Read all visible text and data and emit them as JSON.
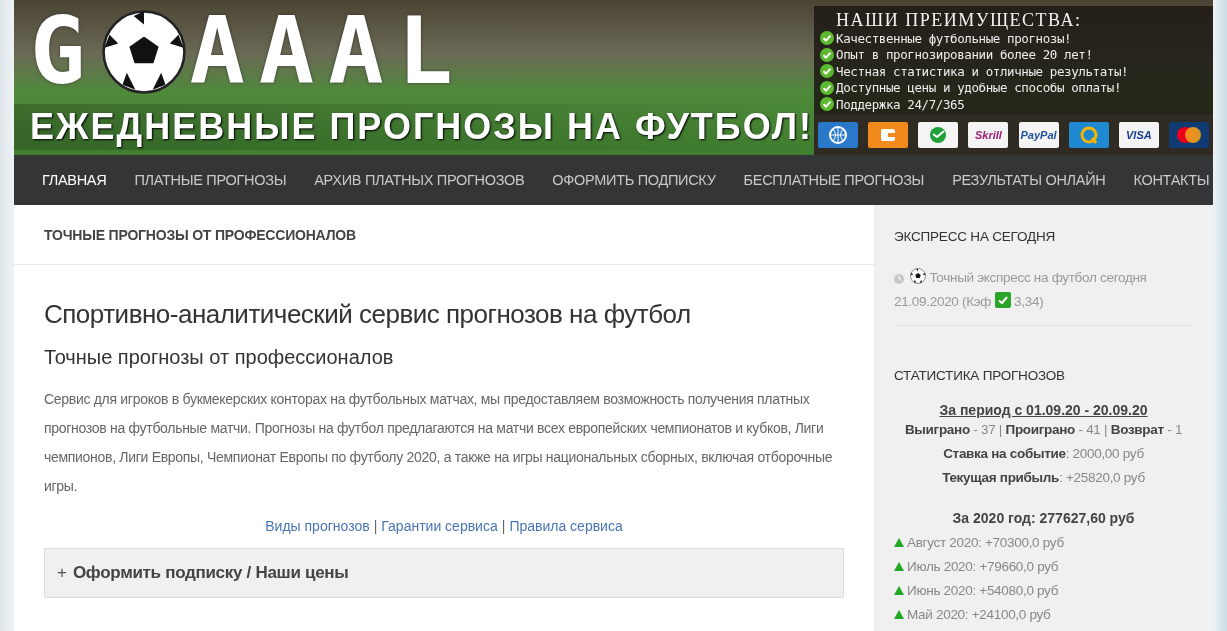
{
  "banner": {
    "logo": {
      "first": "G",
      "rest": "AAAL"
    },
    "tagline": "ЕЖЕДНЕВНЫЕ ПРОГНОЗЫ НА ФУТБОЛ!",
    "advantages": {
      "title": "НАШИ ПРЕИМУЩЕСТВА:",
      "items": [
        "Качественные футбольные прогнозы!",
        "Опыт в прогнозировании более 20 лет!",
        "Честная статистика и отличные результаты!",
        "Доступные цены и удобные способы оплаты!",
        "Поддержка 24/7/365"
      ]
    },
    "payments": [
      {
        "kind": "webmoney"
      },
      {
        "kind": "yandex"
      },
      {
        "kind": "sber"
      },
      {
        "kind": "skrill",
        "text": "Skrill"
      },
      {
        "kind": "paypal",
        "text": "PayPal"
      },
      {
        "kind": "qiwi"
      },
      {
        "kind": "visa",
        "text": "VISA"
      },
      {
        "kind": "mastercard"
      }
    ]
  },
  "nav": [
    {
      "label": "ГЛАВНАЯ",
      "selected": true
    },
    {
      "label": "ПЛАТНЫЕ ПРОГНОЗЫ",
      "selected": false
    },
    {
      "label": "АРХИВ ПЛАТНЫХ ПРОГНОЗОВ",
      "selected": false
    },
    {
      "label": "ОФОРМИТЬ ПОДПИСКУ",
      "selected": false
    },
    {
      "label": "БЕСПЛАТНЫЕ ПРОГНОЗЫ",
      "selected": false
    },
    {
      "label": "РЕЗУЛЬТАТЫ ОНЛАЙН",
      "selected": false
    },
    {
      "label": "КОНТАКТЫ",
      "selected": false
    }
  ],
  "main": {
    "section_title": "ТОЧНЫЕ ПРОГНОЗЫ ОТ ПРОФЕССИОНАЛОВ",
    "heading": "Спортивно-аналитический сервис прогнозов на футбол",
    "subheading": "Точные прогнозы от профессионалов",
    "paragraph": "Сервис для игроков в букмекерских конторах на футбольных матчах, мы предоставляем возможность получения платных прогнозов на футбольные матчи. Прогнозы на футбол предлагаются на матчи всех европейских чемпионатов и кубков, Лиги чемпионов, Лиги Европы, Чемпионат Европы по футболу 2020, а также на игры национальных сборных, включая отборочные игры.",
    "links": [
      "Виды прогнозов",
      "Гарантии сервиса",
      "Правила сервиса"
    ],
    "link_separator": "|",
    "accordion": {
      "sign": "+",
      "label": "Оформить подписку / Наши цены",
      "expanded": false
    }
  },
  "sidebar": {
    "express": {
      "title": "ЭКСПРЕСС НА СЕГОДНЯ",
      "text_before": "Точный экспресс на футбол сегодня 21.09.2020 (Кэф",
      "text_after": "3,34)"
    },
    "stats": {
      "title": "СТАТИСТИКА ПРОГНОЗОВ",
      "period": "За период с 01.09.20 - 20.09.20",
      "lines": [
        "**Выиграно** - 37 | **Проиграно** - 41 | **Возврат** - 1",
        "**Ставка на событие**: 2000,00 руб",
        "**Текущая прибыль**: +25820,0 руб"
      ],
      "year": "За 2020 год: 277627,60 руб",
      "months": [
        "Август 2020: +70300,0 руб",
        "Июль 2020: +79660,0 руб",
        "Июнь 2020: +54080,0 руб",
        "Май 2020: +24100,0 руб"
      ]
    }
  }
}
